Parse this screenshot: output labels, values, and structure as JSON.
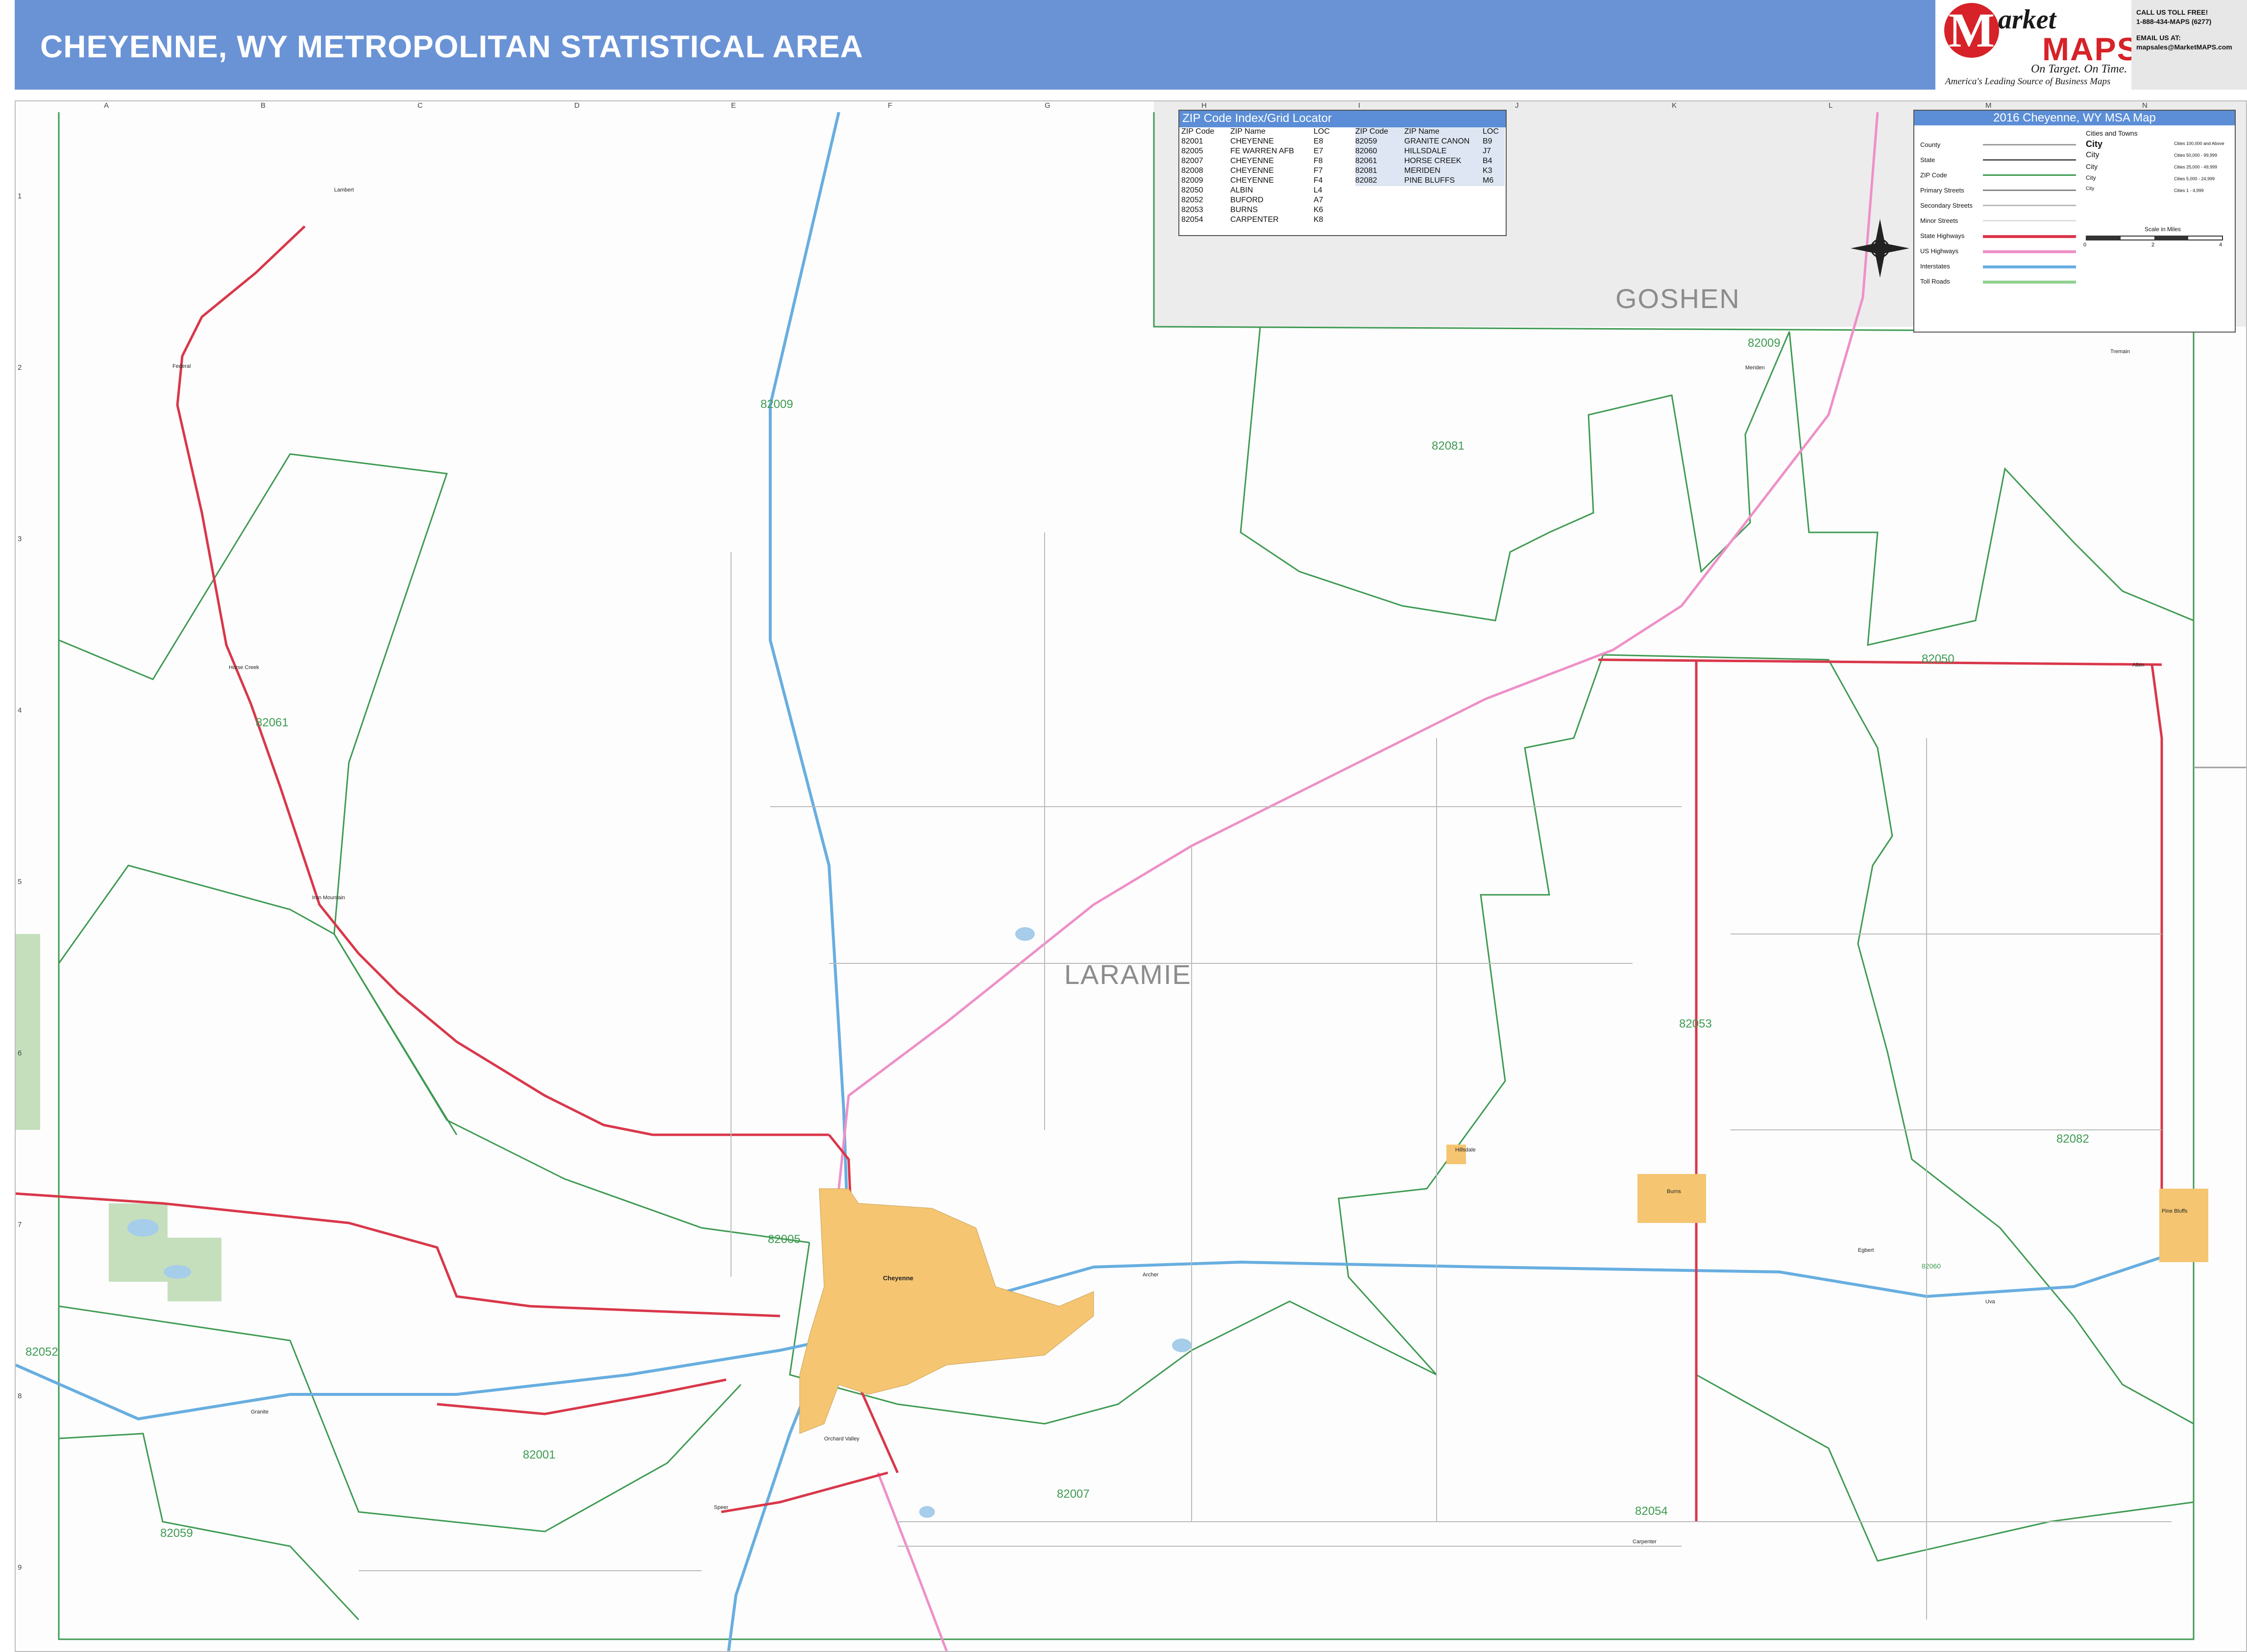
{
  "header": {
    "title": "CHEYENNE, WY METROPOLITAN STATISTICAL AREA",
    "brand_m": "M",
    "brand_arket": "arket",
    "brand_maps": "MAPS",
    "brand_tagline1": "On Target. On Time.",
    "brand_tagline2": "America's Leading Source of Business Maps",
    "contact": [
      "CALL US TOLL FREE!",
      "1-888-434-MAPS (6277)",
      "",
      "EMAIL US AT:",
      "mapsales@MarketMAPS.com"
    ]
  },
  "grid": {
    "columns": [
      "A",
      "B",
      "C",
      "D",
      "E",
      "F",
      "G",
      "H",
      "I",
      "J",
      "K",
      "L",
      "M",
      "N"
    ],
    "rows": [
      "1",
      "2",
      "3",
      "4",
      "5",
      "6",
      "7",
      "8",
      "9"
    ]
  },
  "zip_index": {
    "title": "ZIP Code Index/Grid Locator",
    "headers": [
      "ZIP Code",
      "ZIP Name",
      "LOC"
    ],
    "left": [
      [
        "82001",
        "CHEYENNE",
        "E8"
      ],
      [
        "82005",
        "FE WARREN AFB",
        "E7"
      ],
      [
        "82007",
        "CHEYENNE",
        "F8"
      ],
      [
        "82008",
        "CHEYENNE",
        "F7"
      ],
      [
        "82009",
        "CHEYENNE",
        "F4"
      ],
      [
        "82050",
        "ALBIN",
        "L4"
      ],
      [
        "82052",
        "BUFORD",
        "A7"
      ],
      [
        "82053",
        "BURNS",
        "K6"
      ],
      [
        "82054",
        "CARPENTER",
        "K8"
      ]
    ],
    "right": [
      [
        "82059",
        "GRANITE CANON",
        "B9"
      ],
      [
        "82060",
        "HILLSDALE",
        "J7"
      ],
      [
        "82061",
        "HORSE CREEK",
        "B4"
      ],
      [
        "82081",
        "MERIDEN",
        "K3"
      ],
      [
        "82082",
        "PINE BLUFFS",
        "M6"
      ]
    ]
  },
  "legend": {
    "title": "2016 Cheyenne, WY MSA Map",
    "subtitle": "Cities and Towns",
    "items": [
      {
        "label": "County",
        "color": "#9e9e9e",
        "style": "line"
      },
      {
        "label": "State",
        "color": "#555555",
        "style": "line"
      },
      {
        "label": "ZIP Code",
        "color": "#3e9a52",
        "style": "line"
      },
      {
        "label": "Primary Streets",
        "color": "#888888",
        "style": "line"
      },
      {
        "label": "Secondary Streets",
        "color": "#bbbbbb",
        "style": "line"
      },
      {
        "label": "Minor Streets",
        "color": "#dddddd",
        "style": "line"
      },
      {
        "label": "State Highways",
        "color": "#d9374a",
        "style": "line"
      },
      {
        "label": "US Highways",
        "color": "#ee90c8",
        "style": "line"
      },
      {
        "label": "Interstates",
        "color": "#68aee0",
        "style": "line"
      },
      {
        "label": "Toll Roads",
        "color": "#8fd08f",
        "style": "line"
      }
    ],
    "city_classes": [
      {
        "name": "City",
        "range": "Cities 100,000 and Above"
      },
      {
        "name": "City",
        "range": "Cities 50,000 - 99,999"
      },
      {
        "name": "City",
        "range": "Cities 25,000 - 49,999"
      },
      {
        "name": "City",
        "range": "Cities 5,000 - 24,999"
      },
      {
        "name": "City",
        "range": "Cities 1 - 4,999"
      }
    ],
    "scale_label": "Scale in Miles",
    "scale_ticks": [
      "0",
      "2",
      "4"
    ]
  },
  "counties": [
    "LARAMIE",
    "GOSHEN"
  ],
  "zip_labels": [
    "82009",
    "82081",
    "82061",
    "82050",
    "82053",
    "82082",
    "82005",
    "82052",
    "82001",
    "82007",
    "82059",
    "82054",
    "82009",
    "82060"
  ],
  "places": [
    "Lambert",
    "Federal",
    "Horse Creek",
    "Iron Mountain",
    "Granite",
    "Cheyenne",
    "Orchard Valley",
    "Burns",
    "Hillsdale",
    "Albin",
    "Pine Bluffs",
    "Carpenter",
    "Meriden",
    "Tremain",
    "Egbert",
    "Speer",
    "Archer",
    "Uva"
  ],
  "colors": {
    "header": "#6a93d6",
    "zip_boundary": "#3e9a52",
    "state_hwy": "#d9374a",
    "us_hwy": "#ee90c8",
    "interstate": "#68aee0",
    "city_fill": "#f5c571",
    "goshen_fill": "#ececec",
    "parks": "#c5dfbd"
  }
}
